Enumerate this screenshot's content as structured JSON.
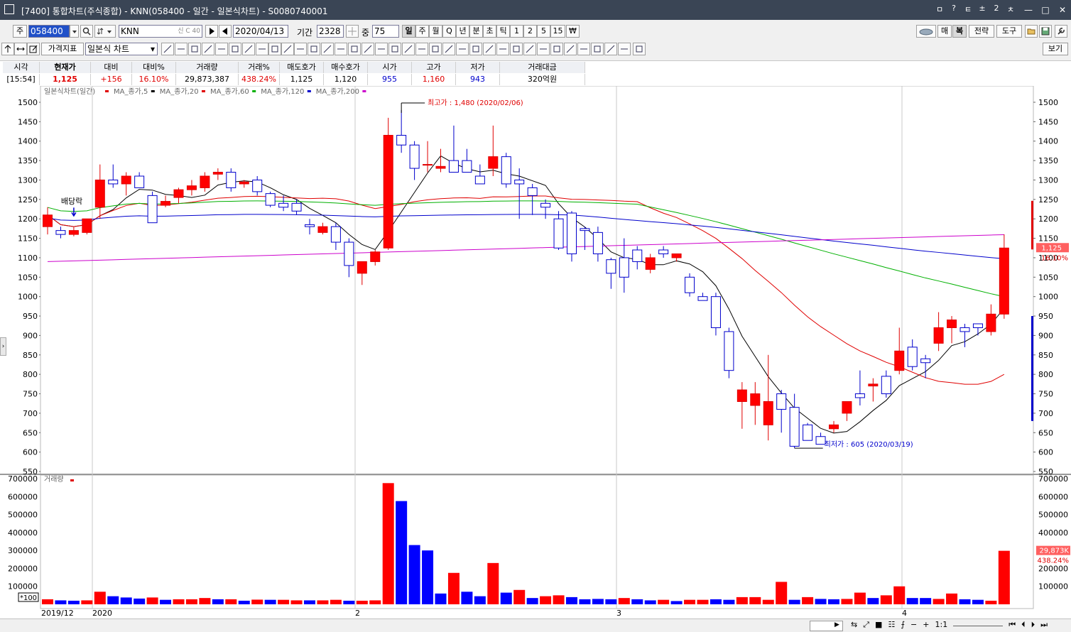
{
  "window": {
    "title": "[7400] 통합차트(주식종합) - KNN(058400 - 일간 - 일본식차트) - S0080740001",
    "top_icons": [
      "ㅁ",
      "?",
      "ㅌ",
      "±",
      "2",
      "ㅊ"
    ]
  },
  "toolbar1": {
    "type_label": "주",
    "code_value": "058400",
    "name_value": "KNN",
    "name_suffix": "신 C 40",
    "date_value": "2020/04/13",
    "period_label": "기간",
    "period_value": "2328",
    "weight_label": "중",
    "weight_value": "75",
    "intervals": [
      "일",
      "주",
      "월",
      "Q",
      "년",
      "분",
      "초",
      "틱",
      "1",
      "2",
      "5",
      "15",
      "₩"
    ],
    "selected_interval": "일",
    "right_buttons": [
      "매",
      "복",
      "전략",
      "도구"
    ]
  },
  "toolbar2": {
    "indicator_button": "가격지표",
    "chart_type_value": "일본식 차트",
    "view_button": "보기"
  },
  "quote": {
    "headers": [
      "시각",
      "현재가",
      "대비",
      "대비%",
      "거래량",
      "거래%",
      "매도호가",
      "매수호가",
      "시가",
      "고가",
      "저가",
      "거래대금"
    ],
    "values": [
      "[15:54]",
      "1,125",
      "+156",
      "16.10%",
      "29,873,387",
      "438.24%",
      "1,125",
      "1,120",
      "955",
      "1,160",
      "943",
      "320억원"
    ],
    "colors": [
      "#000000",
      "#e00000",
      "#e00000",
      "#e00000",
      "#000000",
      "#e00000",
      "#000000",
      "#000000",
      "#0000cc",
      "#e00000",
      "#0000cc",
      "#000000"
    ]
  },
  "chart": {
    "legend_title": "일본식차트(일간)",
    "legend_items": [
      {
        "name": "MA_종가,5",
        "color": "#e00000"
      },
      {
        "name": "MA_종가,20",
        "color": "#000000"
      },
      {
        "name": "MA_종가,60",
        "color": "#e00000"
      },
      {
        "name": "MA_종가,120",
        "color": "#00b000"
      },
      {
        "name": "MA_종가,200",
        "color": "#0000cc"
      }
    ],
    "legend_end_color": "#cc00cc",
    "high_annotation": "최고가 : 1,480 (2020/02/06)",
    "low_annotation": "최저가 : 605 (2020/03/19)",
    "dividend_label": "배당락",
    "current_price_tag": "1,125",
    "current_change_tag": "16.10%",
    "volume_title": "거래량",
    "volume_tag": "29,873K",
    "volume_pct_tag": "438.24%",
    "volume_unit": "*100",
    "date_labels": [
      "2019/12",
      "2020",
      "2",
      "3",
      "4"
    ]
  },
  "chart_data": {
    "type": "candlestick",
    "y_ticks": [
      1500,
      1450,
      1400,
      1350,
      1300,
      1250,
      1200,
      1150,
      1100,
      1050,
      1000,
      950,
      900,
      850,
      800,
      750,
      700,
      650,
      600,
      550
    ],
    "ylim": [
      550,
      1500
    ],
    "volume_ticks": [
      "700000",
      "600000",
      "500000",
      "400000",
      "300000",
      "200000",
      "100000"
    ],
    "volume_ylim": [
      0,
      700000
    ],
    "candles": [
      [
        1180,
        1230,
        1160,
        1210
      ],
      [
        1170,
        1180,
        1150,
        1160
      ],
      [
        1160,
        1180,
        1155,
        1170
      ],
      [
        1165,
        1200,
        1160,
        1200
      ],
      [
        1230,
        1340,
        1200,
        1300
      ],
      [
        1300,
        1340,
        1280,
        1290
      ],
      [
        1290,
        1320,
        1260,
        1310
      ],
      [
        1310,
        1320,
        1290,
        1280
      ],
      [
        1260,
        1270,
        1190,
        1190
      ],
      [
        1235,
        1260,
        1230,
        1245
      ],
      [
        1255,
        1280,
        1240,
        1275
      ],
      [
        1275,
        1300,
        1260,
        1285
      ],
      [
        1280,
        1320,
        1270,
        1310
      ],
      [
        1315,
        1330,
        1300,
        1320
      ],
      [
        1320,
        1330,
        1270,
        1280
      ],
      [
        1290,
        1300,
        1280,
        1295
      ],
      [
        1300,
        1310,
        1260,
        1270
      ],
      [
        1265,
        1270,
        1230,
        1235
      ],
      [
        1240,
        1260,
        1220,
        1230
      ],
      [
        1240,
        1250,
        1210,
        1220
      ],
      [
        1185,
        1200,
        1160,
        1180
      ],
      [
        1165,
        1190,
        1160,
        1180
      ],
      [
        1180,
        1190,
        1120,
        1140
      ],
      [
        1140,
        1150,
        1050,
        1080
      ],
      [
        1060,
        1070,
        1030,
        1090
      ],
      [
        1090,
        1120,
        1080,
        1115
      ],
      [
        1125,
        1460,
        1120,
        1415
      ],
      [
        1415,
        1480,
        1370,
        1390
      ],
      [
        1390,
        1400,
        1300,
        1330
      ],
      [
        1340,
        1400,
        1320,
        1340
      ],
      [
        1330,
        1380,
        1320,
        1335
      ],
      [
        1350,
        1440,
        1320,
        1320
      ],
      [
        1350,
        1380,
        1320,
        1320
      ],
      [
        1310,
        1340,
        1300,
        1290
      ],
      [
        1330,
        1440,
        1310,
        1360
      ],
      [
        1360,
        1370,
        1280,
        1290
      ],
      [
        1300,
        1330,
        1200,
        1290
      ],
      [
        1280,
        1290,
        1210,
        1260
      ],
      [
        1240,
        1250,
        1200,
        1230
      ],
      [
        1200,
        1220,
        1120,
        1125
      ],
      [
        1215,
        1220,
        1090,
        1110
      ],
      [
        1175,
        1180,
        1120,
        1170
      ],
      [
        1165,
        1180,
        1090,
        1110
      ],
      [
        1095,
        1100,
        1020,
        1060
      ],
      [
        1100,
        1150,
        1010,
        1050
      ],
      [
        1120,
        1130,
        1070,
        1090
      ],
      [
        1070,
        1110,
        1060,
        1100
      ],
      [
        1120,
        1130,
        1100,
        1110
      ],
      [
        1100,
        1110,
        1090,
        1110
      ],
      [
        1050,
        1060,
        1000,
        1010
      ],
      [
        1000,
        1010,
        990,
        990
      ],
      [
        1000,
        1010,
        900,
        920
      ],
      [
        910,
        920,
        790,
        810
      ],
      [
        730,
        780,
        660,
        760
      ],
      [
        720,
        780,
        670,
        750
      ],
      [
        670,
        850,
        630,
        730
      ],
      [
        750,
        760,
        650,
        710
      ],
      [
        715,
        750,
        610,
        615
      ],
      [
        670,
        675,
        630,
        630
      ],
      [
        640,
        650,
        620,
        620
      ],
      [
        660,
        680,
        650,
        670
      ],
      [
        700,
        730,
        680,
        730
      ],
      [
        750,
        810,
        720,
        740
      ],
      [
        770,
        790,
        730,
        775
      ],
      [
        795,
        810,
        740,
        750
      ],
      [
        810,
        920,
        800,
        860
      ],
      [
        870,
        890,
        810,
        820
      ],
      [
        840,
        850,
        790,
        830
      ],
      [
        880,
        960,
        860,
        920
      ],
      [
        920,
        950,
        880,
        940
      ],
      [
        920,
        930,
        870,
        910
      ],
      [
        930,
        930,
        900,
        920
      ],
      [
        910,
        980,
        900,
        955
      ],
      [
        955,
        1160,
        943,
        1125
      ]
    ],
    "volumes": [
      [
        28000,
        "r"
      ],
      [
        22000,
        "b"
      ],
      [
        20000,
        "b"
      ],
      [
        22000,
        "r"
      ],
      [
        70000,
        "r"
      ],
      [
        45000,
        "b"
      ],
      [
        38000,
        "b"
      ],
      [
        32000,
        "b"
      ],
      [
        38000,
        "r"
      ],
      [
        25000,
        "b"
      ],
      [
        28000,
        "r"
      ],
      [
        28000,
        "r"
      ],
      [
        35000,
        "r"
      ],
      [
        28000,
        "b"
      ],
      [
        28000,
        "r"
      ],
      [
        20000,
        "b"
      ],
      [
        26000,
        "r"
      ],
      [
        25000,
        "b"
      ],
      [
        25000,
        "r"
      ],
      [
        22000,
        "r"
      ],
      [
        22000,
        "b"
      ],
      [
        22000,
        "r"
      ],
      [
        25000,
        "r"
      ],
      [
        20000,
        "b"
      ],
      [
        20000,
        "r"
      ],
      [
        22000,
        "r"
      ],
      [
        675000,
        "r"
      ],
      [
        575000,
        "b"
      ],
      [
        330000,
        "b"
      ],
      [
        300000,
        "b"
      ],
      [
        60000,
        "b"
      ],
      [
        175000,
        "r"
      ],
      [
        70000,
        "b"
      ],
      [
        45000,
        "b"
      ],
      [
        230000,
        "r"
      ],
      [
        65000,
        "b"
      ],
      [
        80000,
        "r"
      ],
      [
        35000,
        "b"
      ],
      [
        45000,
        "r"
      ],
      [
        50000,
        "r"
      ],
      [
        40000,
        "b"
      ],
      [
        28000,
        "b"
      ],
      [
        30000,
        "b"
      ],
      [
        28000,
        "b"
      ],
      [
        35000,
        "r"
      ],
      [
        28000,
        "b"
      ],
      [
        22000,
        "b"
      ],
      [
        25000,
        "r"
      ],
      [
        18000,
        "b"
      ],
      [
        25000,
        "r"
      ],
      [
        25000,
        "r"
      ],
      [
        28000,
        "b"
      ],
      [
        25000,
        "b"
      ],
      [
        40000,
        "r"
      ],
      [
        40000,
        "r"
      ],
      [
        25000,
        "r"
      ],
      [
        125000,
        "r"
      ],
      [
        25000,
        "b"
      ],
      [
        40000,
        "r"
      ],
      [
        30000,
        "b"
      ],
      [
        28000,
        "b"
      ],
      [
        30000,
        "r"
      ],
      [
        65000,
        "r"
      ],
      [
        35000,
        "b"
      ],
      [
        50000,
        "r"
      ],
      [
        100000,
        "r"
      ],
      [
        35000,
        "b"
      ],
      [
        35000,
        "b"
      ],
      [
        30000,
        "r"
      ],
      [
        60000,
        "r"
      ],
      [
        28000,
        "b"
      ],
      [
        25000,
        "b"
      ],
      [
        20000,
        "r"
      ],
      [
        298000,
        "r"
      ]
    ]
  }
}
